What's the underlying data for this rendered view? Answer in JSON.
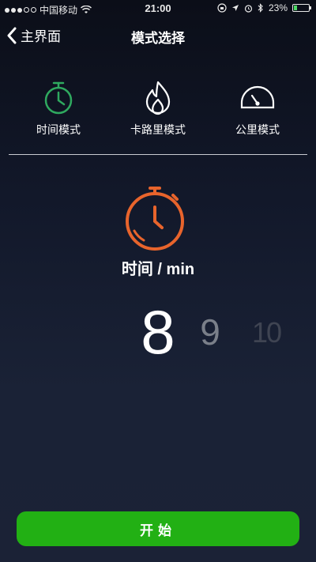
{
  "status_bar": {
    "carrier": "中国移动",
    "time": "21:00",
    "battery_percent": "23%",
    "battery_level": 0.23,
    "icons": [
      "signal-dots",
      "wifi-icon",
      "lock-rotation-icon",
      "location-arrow-icon",
      "alarm-icon",
      "bluetooth-icon",
      "battery-icon"
    ]
  },
  "nav": {
    "back_label": "主界面",
    "title": "模式选择"
  },
  "modes": [
    {
      "label": "时间模式",
      "icon": "stopwatch-icon",
      "active": true,
      "color": "#2fa95f"
    },
    {
      "label": "卡路里模式",
      "icon": "flame-icon",
      "active": false,
      "color": "#ffffff"
    },
    {
      "label": "公里模式",
      "icon": "speedometer-icon",
      "active": false,
      "color": "#ffffff"
    }
  ],
  "current_mode": {
    "icon": "stopwatch-icon",
    "icon_color": "#e8642c",
    "unit_label": "时间 / min"
  },
  "picker": {
    "selected": "8",
    "next": "9",
    "next2": "10"
  },
  "start_button": {
    "label": "开始",
    "color": "#22b014"
  }
}
